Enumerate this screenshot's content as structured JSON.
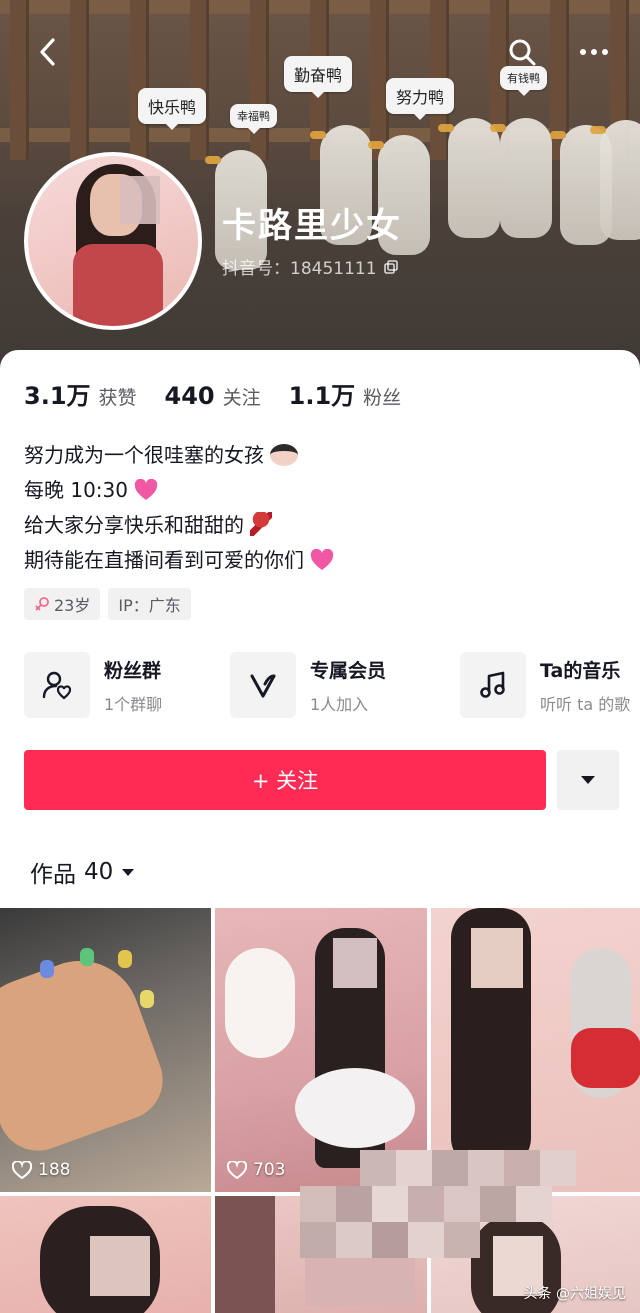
{
  "header": {
    "banner_tags": [
      "勤奋鸭",
      "快乐鸭",
      "幸福鸭",
      "努力鸭",
      "有钱鸭"
    ],
    "nickname": "卡路里少女",
    "douyin_id": "抖音号：18451111",
    "icons": {
      "back": "chevron-left-icon",
      "search": "search-icon",
      "more": "more-dots-icon",
      "copy": "copy-icon"
    }
  },
  "stats": [
    {
      "value": "3.1万",
      "label": "获赞"
    },
    {
      "value": "440",
      "label": "关注"
    },
    {
      "value": "1.1万",
      "label": "粉丝"
    }
  ],
  "bio": {
    "line1": "努力成为一个很哇塞的女孩",
    "line2": "每晚 10:30",
    "line3": "给大家分享快乐和甜甜的",
    "line4": "期待能在直播间看到可爱的你们"
  },
  "tags": {
    "age": "23岁",
    "ip": "IP：广东"
  },
  "features": [
    {
      "title": "粉丝群",
      "subtitle": "1个群聊",
      "icon": "fan-group-icon"
    },
    {
      "title": "专属会员",
      "subtitle": "1人加入",
      "icon": "vip-icon"
    },
    {
      "title": "Ta的音乐",
      "subtitle": "听听 ta 的歌",
      "icon": "music-note-icon"
    }
  ],
  "actions": {
    "follow": "+ 关注"
  },
  "works": {
    "title": "作品",
    "count": "40"
  },
  "grid": [
    {
      "likes": "188"
    },
    {
      "likes": "703"
    }
  ],
  "watermark": "头条 @六姐娱见",
  "colors": {
    "accent": "#fe2c55",
    "text": "#161823",
    "muted": "#8a8b91"
  }
}
